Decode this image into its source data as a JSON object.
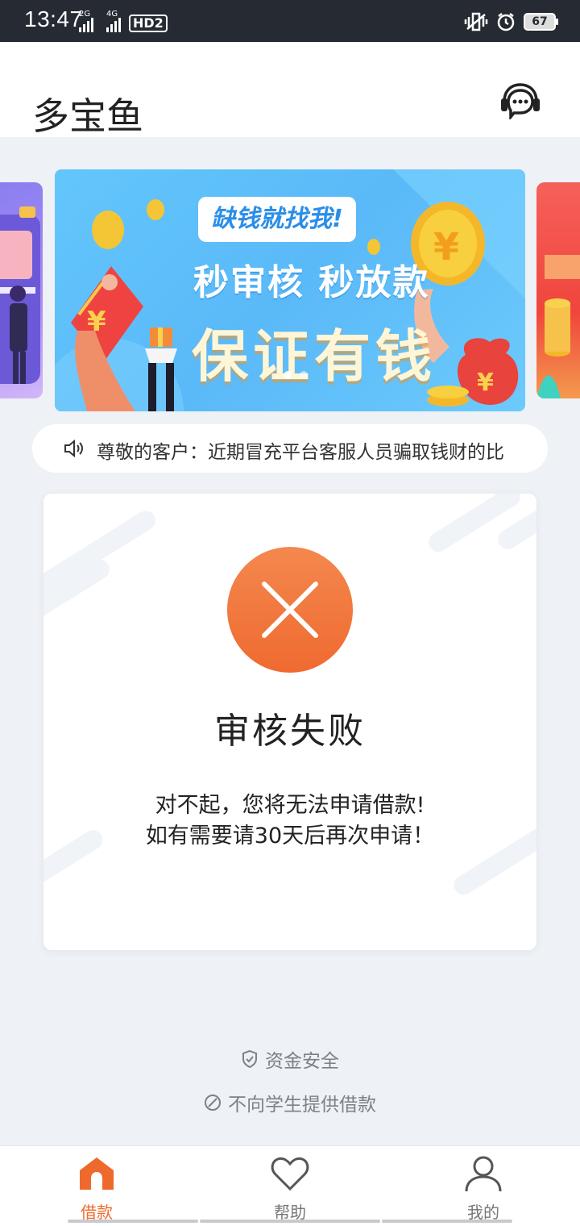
{
  "status_bar": {
    "time": "13:47",
    "sig1_label": "2G",
    "sig2_label": "4G",
    "hd_label": "HD2",
    "battery": "67"
  },
  "header": {
    "title": "多宝鱼",
    "support_icon": "headset-chat-icon"
  },
  "banner": {
    "tag": "缺钱就找我!",
    "line1": "秒审核 秒放款",
    "line2": "保证有钱",
    "page_count": 2,
    "active_index": 0
  },
  "notice": {
    "icon": "speaker-icon",
    "text": "尊敬的客户：近期冒充平台客服人员骗取钱财的比"
  },
  "result": {
    "icon": "close-icon",
    "title": "审核失败",
    "message_line1": "对不起，您将无法申请借款!",
    "message_line2": "如有需要请30天后再次申请！"
  },
  "notes": {
    "safety": "资金安全",
    "no_students": "不向学生提供借款"
  },
  "nav": {
    "items": [
      {
        "label": "借款",
        "icon": "home-icon",
        "active": true
      },
      {
        "label": "帮助",
        "icon": "heart-icon",
        "active": false
      },
      {
        "label": "我的",
        "icon": "user-icon",
        "active": false
      }
    ]
  },
  "colors": {
    "accent": "#ee6a2c",
    "status_bar": "#262a33",
    "banner_blue": "#5ab9f8"
  }
}
